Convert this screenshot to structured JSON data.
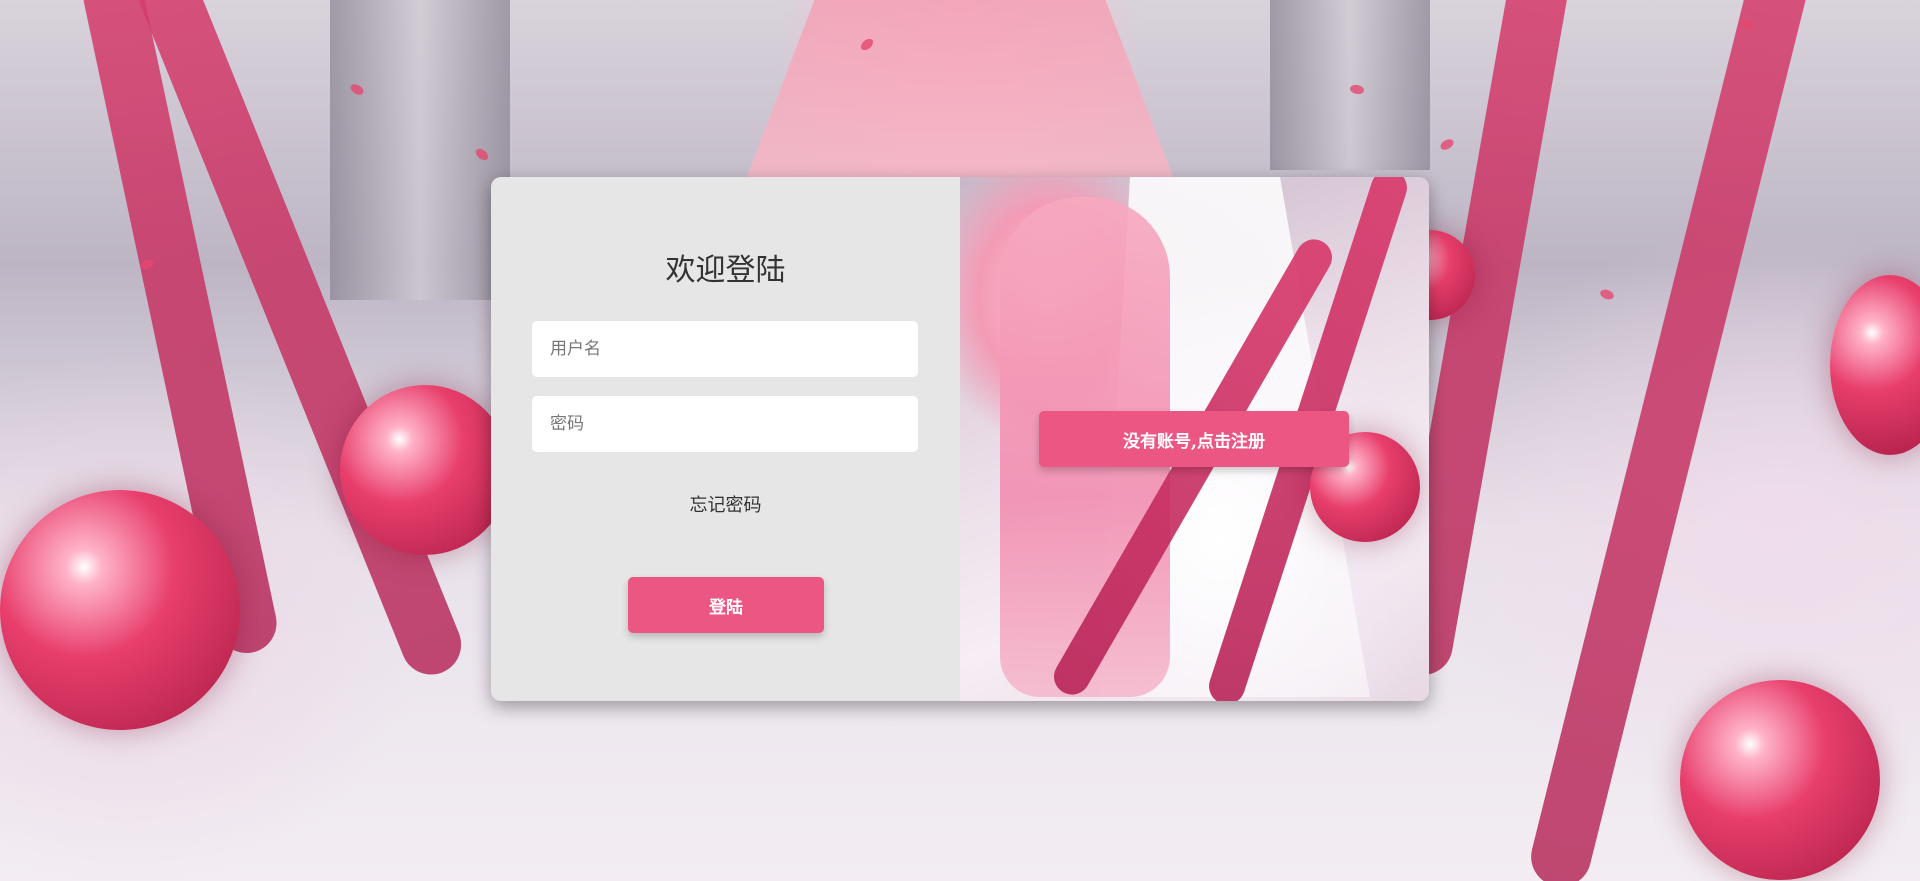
{
  "login": {
    "title": "欢迎登陆",
    "username_placeholder": "用户名",
    "password_placeholder": "密码",
    "forgot_label": "忘记密码",
    "submit_label": "登陆"
  },
  "register": {
    "button_label": "没有账号,点击注册"
  },
  "colors": {
    "accent": "#ec5683",
    "panel_bg": "#e6e6e6",
    "field_bg": "#ffffff",
    "text": "#333333"
  }
}
